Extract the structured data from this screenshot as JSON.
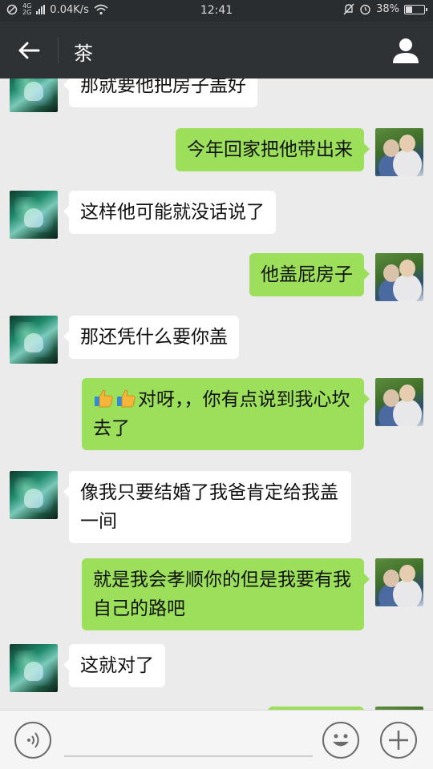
{
  "status_bar": {
    "network_type": "4G",
    "network_type_2": "2G",
    "net_speed": "0.04K/s",
    "time": "12:41",
    "battery": "38%",
    "battery_level": 0.38
  },
  "header": {
    "title": "茶",
    "back_icon": "arrow-left-icon",
    "profile_icon": "person-icon"
  },
  "messages": [
    {
      "side": "left",
      "text": "那就要他把房子盖好"
    },
    {
      "side": "right",
      "text": "今年回家把他带出来"
    },
    {
      "side": "left",
      "text": "这样他可能就没话说了"
    },
    {
      "side": "right",
      "text": "他盖屁房子"
    },
    {
      "side": "left",
      "text": "那还凭什么要你盖"
    },
    {
      "side": "right",
      "emoji": "thumbs-up-icon",
      "text": "对呀，，你有点说到我心坎去了"
    },
    {
      "side": "left",
      "text": "像我只要结婚了我爸肯定给我盖一间"
    },
    {
      "side": "right",
      "text": "就是我会孝顺你的但是我要有我自己的路吧"
    },
    {
      "side": "left",
      "text": "这就对了"
    }
  ],
  "input_bar": {
    "voice_icon": "voice-icon",
    "emoji_icon": "smiley-icon",
    "plus_icon": "plus-icon",
    "input_value": ""
  },
  "colors": {
    "header_bg": "#2f3235",
    "chat_bg": "#ebebeb",
    "bubble_sent": "#9cdf5a",
    "bubble_received": "#ffffff"
  }
}
